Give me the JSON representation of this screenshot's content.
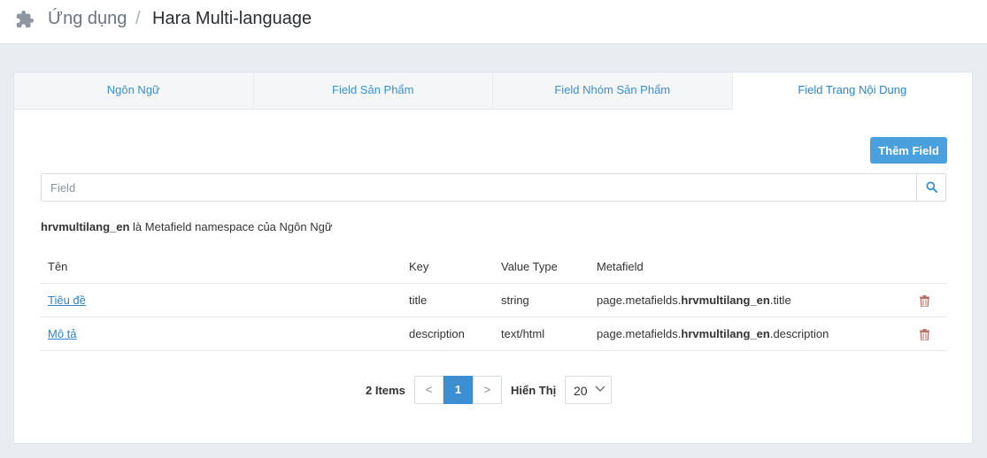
{
  "header": {
    "app_crumb": "Ứng dụng",
    "separator": "/",
    "title": "Hara Multi-language"
  },
  "tabs": [
    {
      "label": "Ngôn Ngữ",
      "active": false
    },
    {
      "label": "Field Sản Phẩm",
      "active": false
    },
    {
      "label": "Field Nhóm Sản Phẩm",
      "active": false
    },
    {
      "label": "Field Trang Nội Dung",
      "active": true
    }
  ],
  "toolbar": {
    "add_label": "Thêm Field"
  },
  "search": {
    "placeholder": "Field",
    "value": "",
    "icon": "search-icon"
  },
  "namespace_note": {
    "namespace": "hrvmultilang_en",
    "text": " là Metafield namespace của Ngôn Ngữ"
  },
  "table": {
    "headers": [
      "Tên",
      "Key",
      "Value Type",
      "Metafield"
    ],
    "rows": [
      {
        "name": "Tiêu đề",
        "key": "title",
        "type": "string",
        "mf_prefix": "page.metafields.",
        "mf_ns": "hrvmultilang_en",
        "mf_suffix": ".title"
      },
      {
        "name": "Mô tả",
        "key": "description",
        "type": "text/html",
        "mf_prefix": "page.metafields.",
        "mf_ns": "hrvmultilang_en",
        "mf_suffix": ".description"
      }
    ]
  },
  "pagination": {
    "count_label": "2 Items",
    "prev": "<",
    "current": "1",
    "next": ">",
    "show_label": "Hiển Thị",
    "page_size": "20"
  },
  "colors": {
    "accent": "#4aa0dc",
    "link": "#2f84c6",
    "trash": "#b5746a"
  }
}
